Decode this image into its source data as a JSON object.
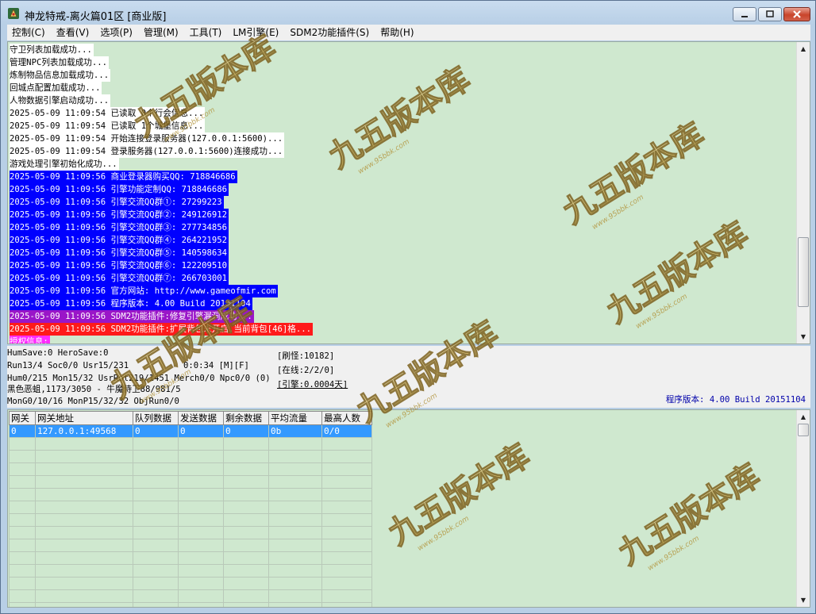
{
  "window": {
    "title": "神龙特戒-离火篇01区 [商业版]",
    "controls": {
      "minimize": "minimize",
      "maximize": "maximize",
      "close": "close"
    }
  },
  "menu": [
    "控制(C)",
    "查看(V)",
    "选项(P)",
    "管理(M)",
    "工具(T)",
    "LM引擎(E)",
    "SDM2功能插件(S)",
    "帮助(H)"
  ],
  "log": [
    {
      "text": "守卫列表加载成功...",
      "style": "white"
    },
    {
      "text": "管理NPC列表加载成功...",
      "style": "white"
    },
    {
      "text": "炼制物品信息加载成功...",
      "style": "white"
    },
    {
      "text": "回城点配置加载成功...",
      "style": "white"
    },
    {
      "text": "人物数据引擎启动成功...",
      "style": "white"
    },
    {
      "text": "2025-05-09 11:09:54 已读取 0个行会信息...",
      "style": "white"
    },
    {
      "text": "2025-05-09 11:09:54 已读取 1个城堡信息...",
      "style": "white"
    },
    {
      "text": "2025-05-09 11:09:54 开始连接登录服务器(127.0.0.1:5600)...",
      "style": "white"
    },
    {
      "text": "2025-05-09 11:09:54 登录服务器(127.0.0.1:5600)连接成功...",
      "style": "white"
    },
    {
      "text": "游戏处理引擎初始化成功...",
      "style": "white"
    },
    {
      "text": "2025-05-09 11:09:56 商业登录器购买QQ: 718846686",
      "style": "blue"
    },
    {
      "text": "2025-05-09 11:09:56 引擎功能定制QQ: 718846686",
      "style": "blue"
    },
    {
      "text": "2025-05-09 11:09:56 引擎交流QQ群①: 27299223",
      "style": "blue"
    },
    {
      "text": "2025-05-09 11:09:56 引擎交流QQ群②: 249126912",
      "style": "blue"
    },
    {
      "text": "2025-05-09 11:09:56 引擎交流QQ群③: 277734856",
      "style": "blue"
    },
    {
      "text": "2025-05-09 11:09:56 引擎交流QQ群④: 264221952",
      "style": "blue"
    },
    {
      "text": "2025-05-09 11:09:56 引擎交流QQ群⑤: 140598634",
      "style": "blue"
    },
    {
      "text": "2025-05-09 11:09:56 引擎交流QQ群⑥: 122209510",
      "style": "blue"
    },
    {
      "text": "2025-05-09 11:09:56 引擎交流QQ群⑦: 266703001",
      "style": "blue"
    },
    {
      "text": "2025-05-09 11:09:56 官方网站: http://www.gameofmir.com",
      "style": "blue"
    },
    {
      "text": "2025-05-09 11:09:56 程序版本: 4.00 Build 20151104",
      "style": "blue"
    },
    {
      "text": "2025-05-09 11:09:56 SDM2功能插件:修复引擎漏洞成功...",
      "style": "purple"
    },
    {
      "text": "2025-05-09 11:09:56 SDM2功能插件:扩展背包未开启,当前背包[46]格...",
      "style": "red"
    },
    {
      "text": "授权信息:",
      "style": "magenta"
    }
  ],
  "status": {
    "line1": "HumSave:0 HeroSave:0",
    "line2a": "Run13/4 Soc0/0 Usr15/231",
    "line2b": "0:0:34 [M][F]",
    "line3a": "Hum0/215 Mon15/32 UsrRot219/1451 Merch0/0 Npc0/0 (0)",
    "line4": "黑色恶蛆,1173/3050 - 牛魔侍卫88/981/5",
    "line5": "MonG0/10/16 MonP15/32/32 ObjRun0/0",
    "refresh": "[刷怪:10182]",
    "online": "[在线:2/2/0]",
    "engine": "[引擎:0.0004天]",
    "version": "程序版本: 4.00 Build 20151104"
  },
  "gate_table": {
    "columns": [
      "网关",
      "网关地址",
      "队列数据",
      "发送数据",
      "剩余数据",
      "平均流量",
      "最高人数"
    ],
    "rows": [
      [
        "0",
        "127.0.0.1:49568",
        "0",
        "0",
        "0",
        "0b",
        "0/0"
      ]
    ],
    "empty_rows": 14
  },
  "watermark": {
    "text": "九五版本库",
    "url": "www.95bbk.com"
  },
  "colors": {
    "log_bg": "#cfe8cf",
    "highlight_blue": "#0000ff",
    "highlight_purple": "#9a16c8",
    "highlight_red": "#ff1a1a",
    "highlight_magenta": "#ff2aff",
    "selection": "#3399ff",
    "version_text": "#0000aa"
  }
}
